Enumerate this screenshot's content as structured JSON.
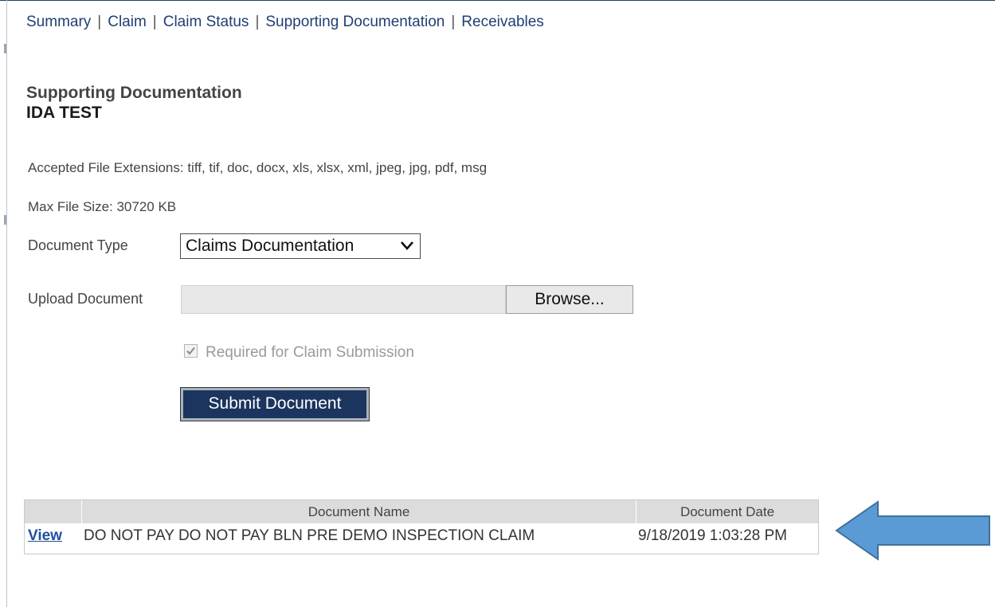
{
  "nav": {
    "items": [
      "Summary",
      "Claim",
      "Claim Status",
      "Supporting Documentation",
      "Receivables"
    ],
    "separator": "|"
  },
  "page": {
    "title": "Supporting Documentation",
    "subtitle": "IDA TEST"
  },
  "info": {
    "accepted_extensions": "Accepted File Extensions: tiff, tif, doc, docx, xls, xlsx, xml, jpeg, jpg, pdf, msg",
    "max_file_size": "Max File Size: 30720 KB"
  },
  "form": {
    "document_type_label": "Document Type",
    "document_type_value": "Claims Documentation",
    "upload_label": "Upload Document",
    "upload_value": "",
    "browse_label": "Browse...",
    "required_label": "Required for Claim Submission",
    "required_checked": true,
    "submit_label": "Submit Document"
  },
  "table": {
    "columns": [
      "Document Name",
      "Document Date"
    ],
    "rows": [
      {
        "action": "View",
        "name": "DO NOT PAY DO NOT PAY BLN PRE DEMO INSPECTION CLAIM",
        "date": "9/18/2019 1:03:28 PM"
      }
    ]
  },
  "colors": {
    "nav_link": "#1f3f73",
    "submit_bg": "#1b355e",
    "arrow_fill": "#5b9bd5",
    "arrow_stroke": "#41719c"
  }
}
